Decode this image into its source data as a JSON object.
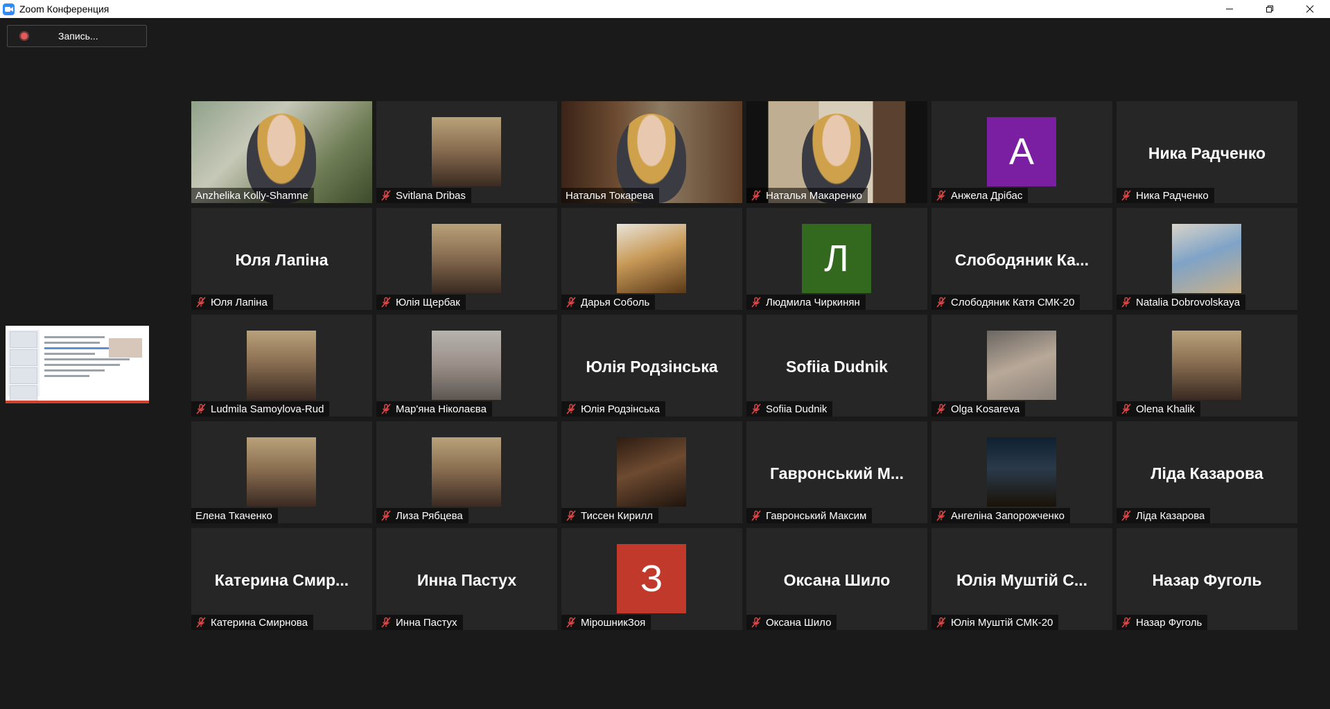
{
  "window": {
    "title": "Zoom Конференция",
    "controls": [
      "minimize-icon",
      "restore-icon",
      "close-icon"
    ]
  },
  "record": {
    "label": "Запись..."
  },
  "colors": {
    "active_speaker_outline": "#c5e463",
    "accent": "#2d8cff",
    "muted_icon": "#e04848"
  },
  "participants": [
    {
      "name": "Anzhelika Kolly-Shamne",
      "muted": false,
      "active": true,
      "view": "video"
    },
    {
      "name": "Svitlana Dribas",
      "muted": true,
      "view": "photo",
      "photo": "woman-portrait-photo"
    },
    {
      "name": "Наталья Токарева",
      "muted": false,
      "view": "video"
    },
    {
      "name": "Наталья Макаренко",
      "muted": true,
      "view": "video"
    },
    {
      "name": "Анжела Дрібас",
      "muted": true,
      "view": "letter",
      "letter": "А",
      "color": "#7b1fa2"
    },
    {
      "name": "Ника Радченко",
      "muted": true,
      "view": "name",
      "display": "Ника Радченко"
    },
    {
      "name": "Юля Лапіна",
      "muted": true,
      "view": "name",
      "display": "Юля Лапіна"
    },
    {
      "name": "Юлія Щербак",
      "muted": true,
      "view": "photo",
      "photo": "woman-portrait-photo"
    },
    {
      "name": "Дарья Соболь",
      "muted": true,
      "view": "photo",
      "photo": "sable-animal-photo"
    },
    {
      "name": "Людмила Чиркинян",
      "muted": true,
      "view": "letter",
      "letter": "Л",
      "color": "#33691e"
    },
    {
      "name": "Слободяник Катя СМК-20",
      "muted": true,
      "view": "name",
      "display": "Слободяник Ка..."
    },
    {
      "name": "Natalia Dobrovolskaya",
      "muted": true,
      "view": "photo",
      "photo": "anime-art-photo"
    },
    {
      "name": "Ludmila Samoylova-Rud",
      "muted": true,
      "view": "photo",
      "photo": "woman-portrait-photo"
    },
    {
      "name": "Мар'яна Ніколаєва",
      "muted": true,
      "view": "photo",
      "photo": "girl-portrait-photo"
    },
    {
      "name": "Юлія Родзінська",
      "muted": true,
      "view": "name",
      "display": "Юлія Родзінська"
    },
    {
      "name": "Sofiia Dudnik",
      "muted": true,
      "view": "name",
      "display": "Sofiia Dudnik"
    },
    {
      "name": "Olga Kosareva",
      "muted": true,
      "view": "photo",
      "photo": "hedgehog-photo"
    },
    {
      "name": "Olena Khalik",
      "muted": true,
      "view": "photo",
      "photo": "woman-portrait-photo"
    },
    {
      "name": "Елена Ткаченко",
      "muted": false,
      "view": "photo",
      "photo": "woman-portrait-photo"
    },
    {
      "name": "Лиза Рябцева",
      "muted": true,
      "view": "photo",
      "photo": "woman-portrait-photo"
    },
    {
      "name": "Тиссен Кирилл",
      "muted": true,
      "view": "photo",
      "photo": "chekhov-portrait-photo"
    },
    {
      "name": "Гавронський Максим",
      "muted": true,
      "view": "name",
      "display": "Гавронський М..."
    },
    {
      "name": "Ангеліна Запорожченко",
      "muted": true,
      "view": "photo",
      "photo": "night-city-photo"
    },
    {
      "name": "Ліда Казарова",
      "muted": true,
      "view": "name",
      "display": "Ліда Казарова"
    },
    {
      "name": "Катерина Смирнова",
      "muted": true,
      "view": "name",
      "display": "Катерина Смир..."
    },
    {
      "name": "Инна Пастух",
      "muted": true,
      "view": "name",
      "display": "Инна Пастух"
    },
    {
      "name": "МірошникЗоя",
      "muted": true,
      "view": "letter",
      "letter": "З",
      "color": "#c0392b"
    },
    {
      "name": "Оксана Шило",
      "muted": true,
      "view": "name",
      "display": "Оксана Шило"
    },
    {
      "name": "Юлія Муштій СМК-20",
      "muted": true,
      "view": "name",
      "display": "Юлія Муштій С..."
    },
    {
      "name": "Назар Фуголь",
      "muted": true,
      "view": "name",
      "display": "Назар Фуголь"
    }
  ]
}
